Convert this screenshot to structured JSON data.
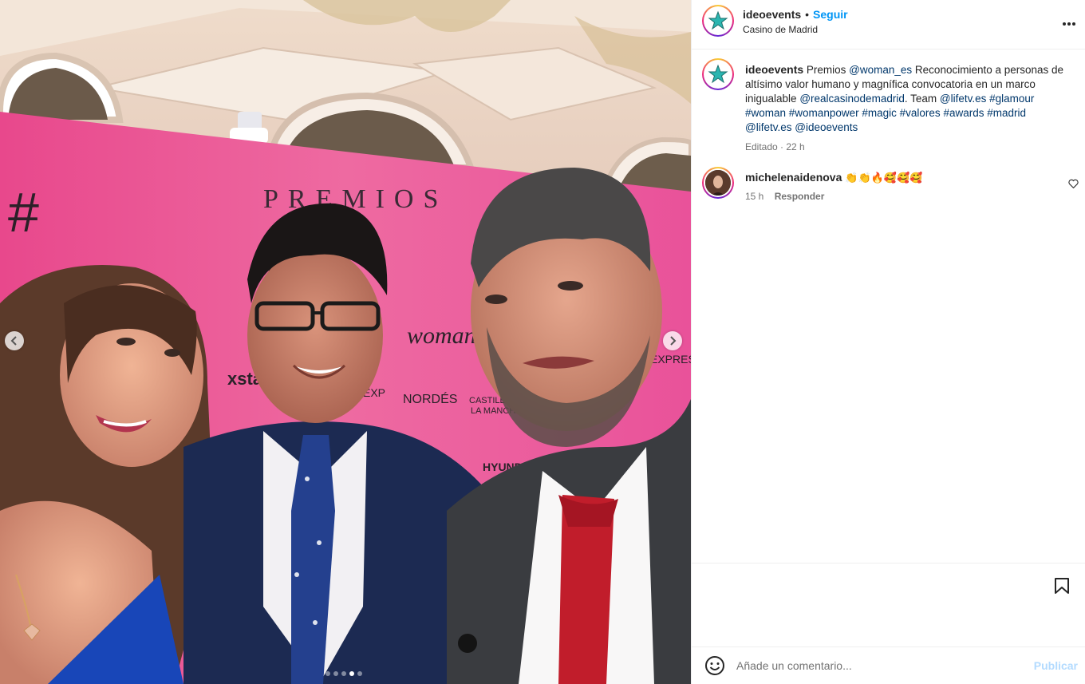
{
  "post": {
    "username": "ideoevents",
    "separator": "•",
    "follow_label": "Seguir",
    "location": "Casino de Madrid",
    "more_icon": "more-horizontal-icon"
  },
  "caption": {
    "username": "ideoevents",
    "segments": [
      {
        "text": "Premios ",
        "type": "text"
      },
      {
        "text": "@woman_es",
        "type": "mention"
      },
      {
        "text": " Reconocimiento a personas de altísimo valor humano y magnífica convocatoria en un marco inigualable ",
        "type": "text"
      },
      {
        "text": "@realcasinodemadrid",
        "type": "mention"
      },
      {
        "text": ". Team ",
        "type": "text"
      },
      {
        "text": "@lifetv.es",
        "type": "mention"
      },
      {
        "text": " ",
        "type": "text"
      },
      {
        "text": "#glamour",
        "type": "tag"
      },
      {
        "text": " ",
        "type": "text"
      },
      {
        "text": "#woman",
        "type": "tag"
      },
      {
        "text": " ",
        "type": "text"
      },
      {
        "text": "#womanpower",
        "type": "tag"
      },
      {
        "text": " ",
        "type": "text"
      },
      {
        "text": "#magic",
        "type": "tag"
      },
      {
        "text": " ",
        "type": "text"
      },
      {
        "text": "#valores",
        "type": "tag"
      },
      {
        "text": " ",
        "type": "text"
      },
      {
        "text": "#awards",
        "type": "tag"
      },
      {
        "text": " ",
        "type": "text"
      },
      {
        "text": "#madrid",
        "type": "tag"
      },
      {
        "text": " ",
        "type": "text"
      },
      {
        "text": "@lifetv.es",
        "type": "mention"
      },
      {
        "text": " ",
        "type": "text"
      },
      {
        "text": "@ideoevents",
        "type": "mention"
      }
    ],
    "meta": "Editado · 22 h"
  },
  "comment": {
    "username": "michelenaidenova",
    "text": "👏👏🔥🥰🥰🥰",
    "time": "15 h",
    "reply_label": "Responder"
  },
  "carousel": {
    "total": 5,
    "active_index": 3
  },
  "composer": {
    "placeholder": "Añade un comentario...",
    "publish_label": "Publicar"
  },
  "colors": {
    "accent": "#0095f6",
    "link": "#00376b",
    "muted": "#737373",
    "backdrop_pink": "#e94b8e",
    "logo_teal": "#2bb5b0"
  }
}
